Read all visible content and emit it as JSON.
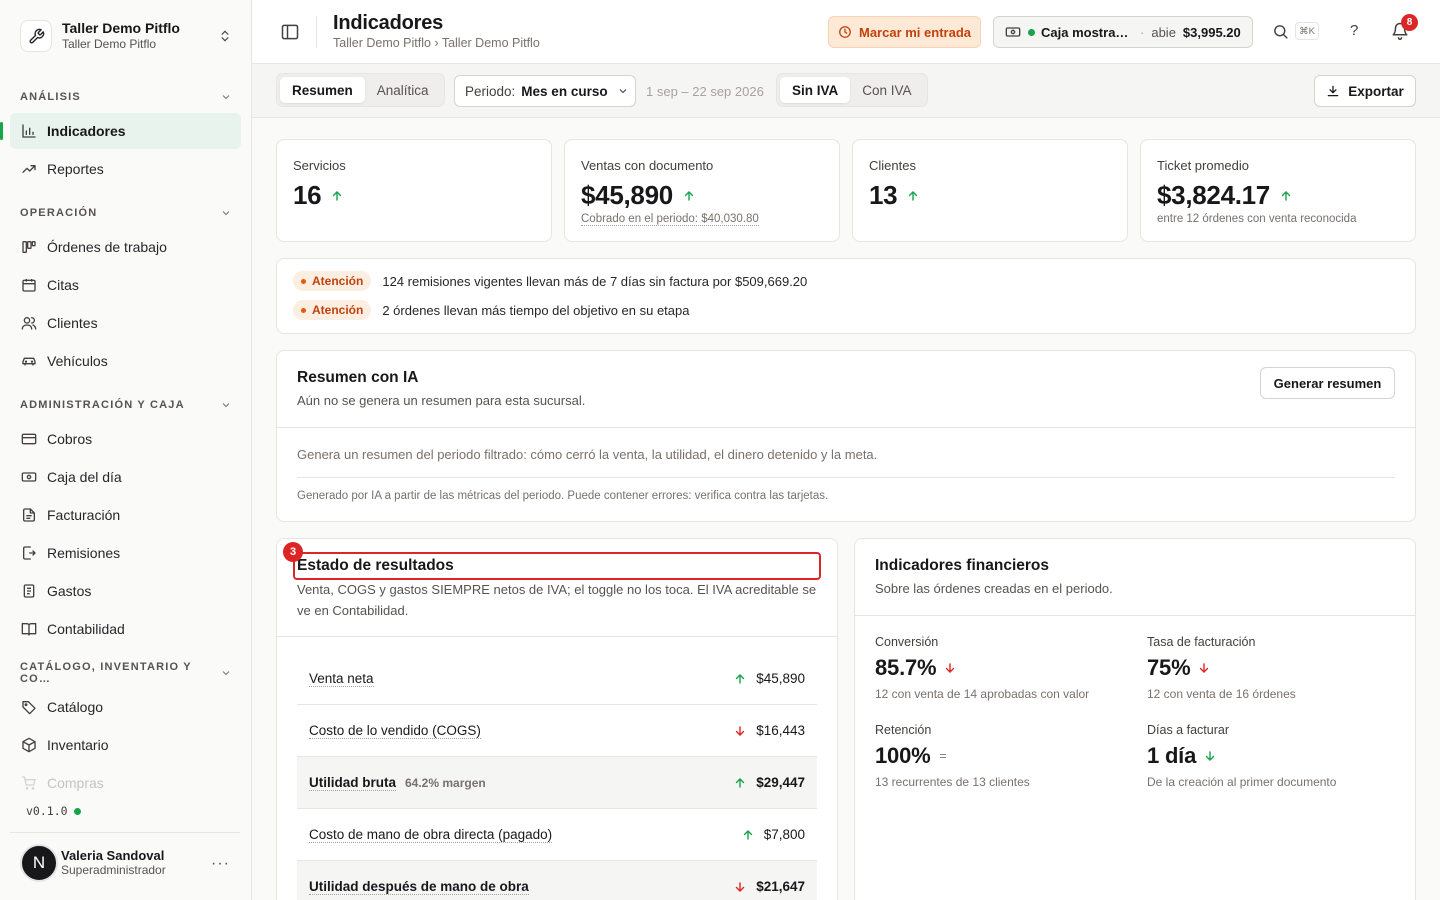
{
  "workspace": {
    "name": "Taller Demo Pitflo",
    "subtitle": "Taller Demo Pitflo"
  },
  "sidebar": {
    "sections": [
      {
        "label": "ANÁLISIS"
      },
      {
        "label": "OPERACIÓN"
      },
      {
        "label": "ADMINISTRACIÓN Y CAJA"
      },
      {
        "label": "CATÁLOGO, INVENTARIO Y CO…"
      }
    ],
    "items": [
      {
        "label": "Indicadores",
        "icon": "bar-chart-icon"
      },
      {
        "label": "Reportes",
        "icon": "trend-icon"
      },
      {
        "label": "Órdenes de trabajo",
        "icon": "kanban-icon"
      },
      {
        "label": "Citas",
        "icon": "calendar-icon"
      },
      {
        "label": "Clientes",
        "icon": "users-icon"
      },
      {
        "label": "Vehículos",
        "icon": "car-icon"
      },
      {
        "label": "Cobros",
        "icon": "credit-card-icon"
      },
      {
        "label": "Caja del día",
        "icon": "cash-icon"
      },
      {
        "label": "Facturación",
        "icon": "document-icon"
      },
      {
        "label": "Remisiones",
        "icon": "file-export-icon"
      },
      {
        "label": "Gastos",
        "icon": "receipt-icon"
      },
      {
        "label": "Contabilidad",
        "icon": "book-icon"
      },
      {
        "label": "Catálogo",
        "icon": "tag-icon"
      },
      {
        "label": "Inventario",
        "icon": "box-icon"
      },
      {
        "label": "Compras",
        "icon": "cart-icon"
      }
    ],
    "version": "v0.1.0"
  },
  "user": {
    "initial": "N",
    "name": "Valeria Sandoval",
    "role": "Superadministrador",
    "menu": "···"
  },
  "header": {
    "title": "Indicadores",
    "breadcrumb": "Taller Demo Pitflo › Taller Demo Pitflo",
    "entrada_button": "Marcar mi entrada",
    "caja": {
      "name": "Caja mostrador principal",
      "sep": "·",
      "status": "abie",
      "amount": "$3,995.20"
    },
    "search_shortcut": "⌘K",
    "help": "?",
    "notifications": "8"
  },
  "toolbar": {
    "view_tabs": [
      "Resumen",
      "Analítica"
    ],
    "period_label": "Periodo:",
    "period_value": "Mes en curso",
    "date_range": "1 sep – 22 sep 2026",
    "iva_tabs": [
      "Sin IVA",
      "Con IVA"
    ],
    "export": "Exportar"
  },
  "kpis": [
    {
      "label": "Servicios",
      "value": "16",
      "sub": ""
    },
    {
      "label": "Ventas con documento",
      "value": "$45,890",
      "sub": "Cobrado en el periodo: $40,030.80"
    },
    {
      "label": "Clientes",
      "value": "13",
      "sub": ""
    },
    {
      "label": "Ticket promedio",
      "value": "$3,824.17",
      "sub": "entre 12 órdenes con venta reconocida"
    }
  ],
  "alerts": [
    {
      "tag": "Atención",
      "text": "124 remisiones vigentes llevan más de 7 días sin factura por $509,669.20"
    },
    {
      "tag": "Atención",
      "text": "2 órdenes llevan más tiempo del objetivo en su etapa"
    }
  ],
  "ai_summary": {
    "title": "Resumen con IA",
    "subtitle": "Aún no se genera un resumen para esta sucursal.",
    "button": "Generar resumen",
    "body": "Genera un resumen del periodo filtrado: cómo cerró la venta, la utilidad, el dinero detenido y la meta.",
    "note": "Generado por IA a partir de las métricas del periodo. Puede contener errores: verifica contra las tarjetas."
  },
  "income_statement": {
    "marker": "3",
    "title": "Estado de resultados",
    "description": "Venta, COGS y gastos SIEMPRE netos de IVA; el toggle no los toca. El IVA acreditable se ve en Contabilidad.",
    "rows": [
      {
        "label": "Venta neta",
        "margin": "",
        "value": "$45,890",
        "trend": "up"
      },
      {
        "label": "Costo de lo vendido (COGS)",
        "margin": "",
        "value": "$16,443",
        "trend": "down"
      },
      {
        "label": "Utilidad bruta",
        "margin": "64.2% margen",
        "value": "$29,447",
        "trend": "up"
      },
      {
        "label": "Costo de mano de obra directa (pagado)",
        "margin": "",
        "value": "$7,800",
        "trend": "up"
      },
      {
        "label": "Utilidad después de mano de obra",
        "margin": "",
        "value": "$21,647",
        "trend": "down"
      }
    ]
  },
  "financial": {
    "title": "Indicadores financieros",
    "subtitle": "Sobre las órdenes creadas en el periodo.",
    "metrics": [
      {
        "label": "Conversión",
        "value": "85.7%",
        "sub": "12 con venta de 14 aprobadas con valor",
        "trend": "down"
      },
      {
        "label": "Tasa de facturación",
        "value": "75%",
        "sub": "12 con venta de 16 órdenes",
        "trend": "down"
      },
      {
        "label": "Retención",
        "value": "100%",
        "sub": "13 recurrentes de 13 clientes",
        "trend": "flat",
        "flat_symbol": "="
      },
      {
        "label": "Días a facturar",
        "value": "1 día",
        "sub": "De la creación al primer documento",
        "trend": "down"
      }
    ]
  },
  "colors": {
    "up": "#16a34a",
    "down": "#dc2626",
    "accent": "#16a34a",
    "warning": "#c2410c",
    "focus": "#dc2626"
  }
}
